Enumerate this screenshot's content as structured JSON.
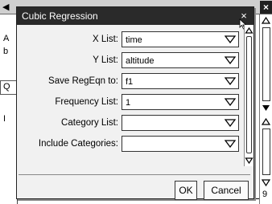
{
  "background": {
    "left_letters": [
      "A",
      "b",
      "Q",
      "I"
    ],
    "right_number": "9",
    "close_glyph": "×",
    "tab_arrow_glyph": "◀"
  },
  "dialog": {
    "title": "Cubic Regression",
    "close_glyph": "×",
    "fields": [
      {
        "label": "X List:",
        "value": "time"
      },
      {
        "label": "Y List:",
        "value": "altitude"
      },
      {
        "label": "Save RegEqn to:",
        "value": "f1"
      },
      {
        "label": "Frequency List:",
        "value": "1"
      },
      {
        "label": "Category List:",
        "value": ""
      },
      {
        "label": "Include Categories:",
        "value": ""
      }
    ],
    "buttons": {
      "ok": "OK",
      "cancel": "Cancel"
    }
  },
  "colors": {
    "titlebar": "#2a2a2a",
    "dialog_bg": "#f1f1f1"
  }
}
